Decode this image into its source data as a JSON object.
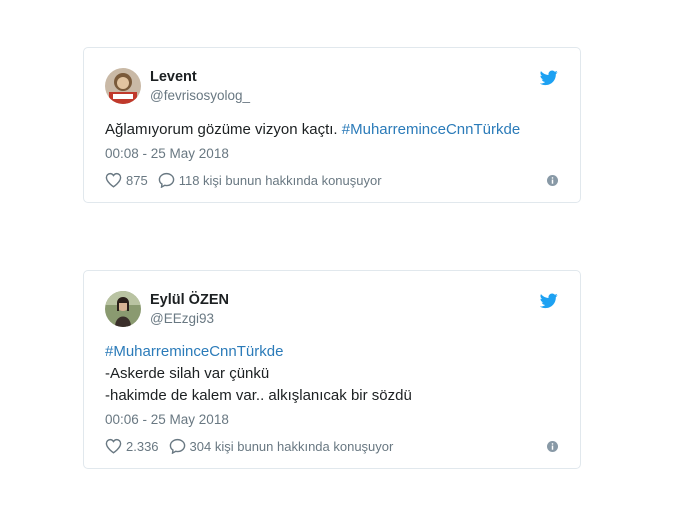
{
  "tweets": [
    {
      "name": "Levent",
      "handle": "@fevrisosyolog_",
      "text": "Ağlamıyorum gözüme vizyon kaçtı.",
      "hashtag": "#MuharreminceCnnTürkde",
      "time": "00:08 - 25 May 2018",
      "likes": "875",
      "comments": "118 kişi bunun hakkında konuşuyor"
    },
    {
      "name": "Eylül ÖZEN",
      "handle": "@EEzgi93",
      "hashtag": "#MuharreminceCnnTürkde",
      "line1": "-Askerde silah var çünkü",
      "line2": "-hakimde de kalem var.. alkışlanıcak bir sözdü",
      "time": "00:06 - 25 May 2018",
      "likes": "2.336",
      "comments": "304 kişi bunun hakkında konuşuyor"
    }
  ],
  "colors": {
    "link": "#2b7bb9",
    "muted": "#697882",
    "twitter": "#1da1f2"
  },
  "icons": [
    "twitter-bird-icon",
    "heart-icon",
    "comment-icon",
    "info-icon"
  ]
}
